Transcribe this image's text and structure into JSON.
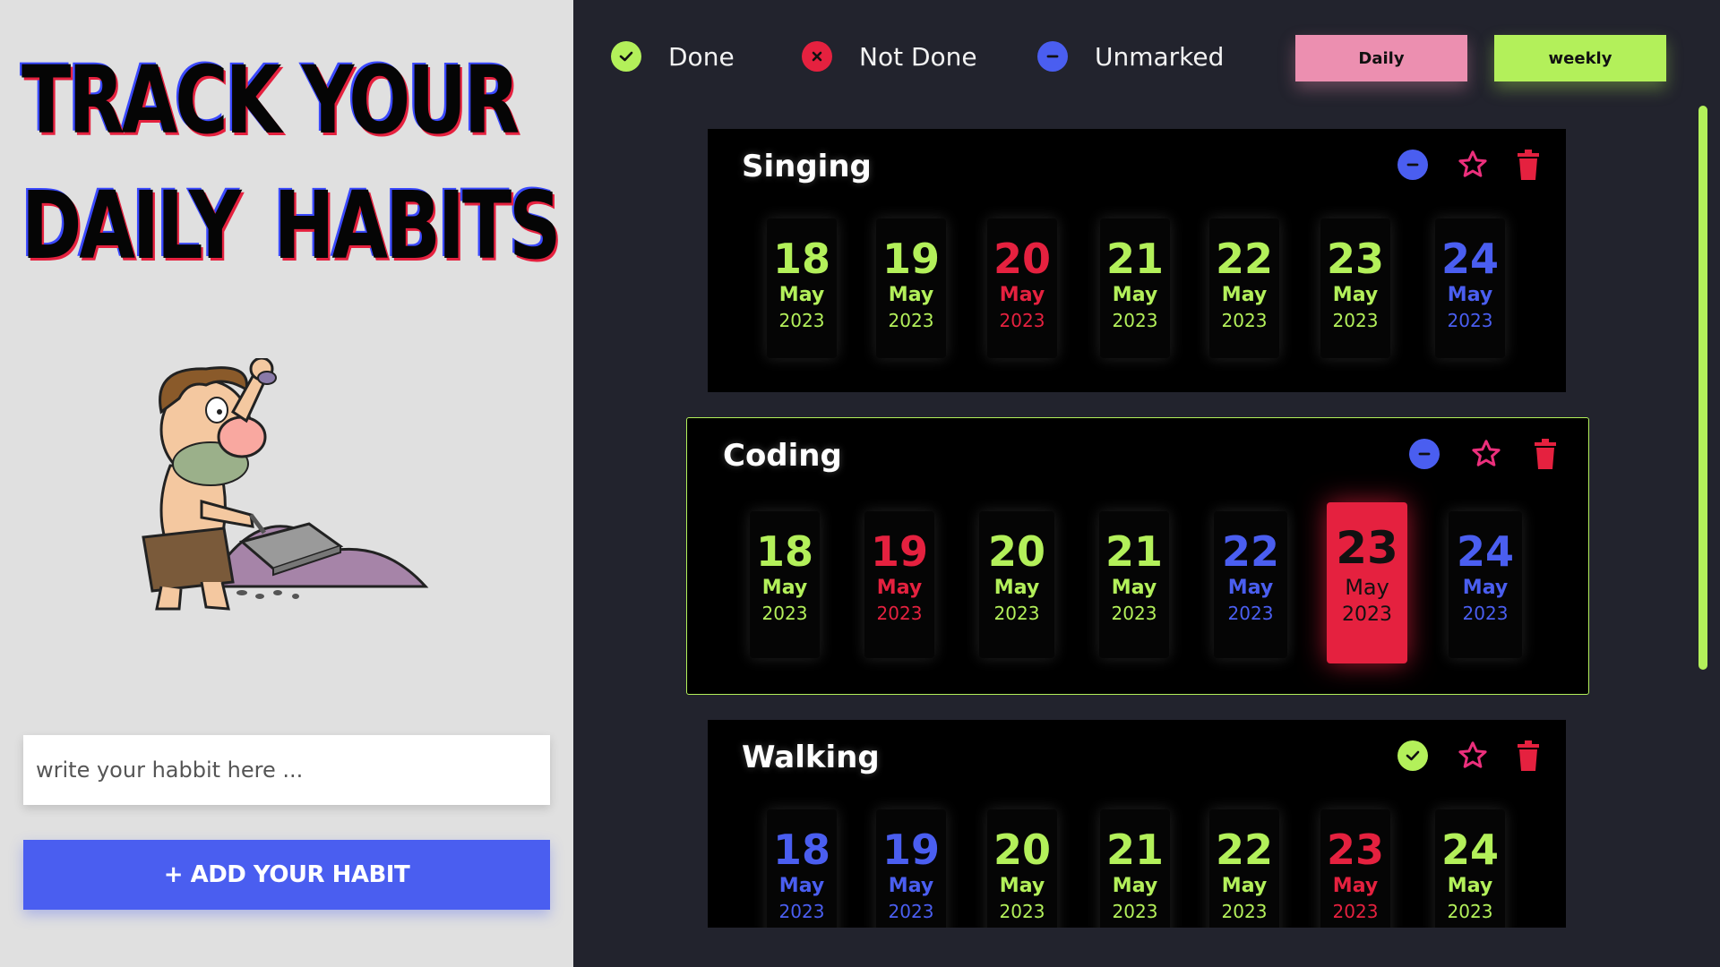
{
  "headline": {
    "line1": "TRACK YOUR",
    "line2": "DAILY HABITS"
  },
  "input": {
    "placeholder": "write your habbit here ..."
  },
  "add_button": {
    "label": "+ ADD YOUR HABIT"
  },
  "legend": {
    "done": {
      "label": "Done",
      "icon": "check-icon",
      "color": "#b3f05a"
    },
    "not_done": {
      "label": "Not Done",
      "icon": "x-icon",
      "color": "#e5213f"
    },
    "unmarked": {
      "label": "Unmarked",
      "icon": "minus-icon",
      "color": "#4a5ef0"
    }
  },
  "tabs": {
    "daily": "Daily",
    "weekly": "weekly"
  },
  "habits": [
    {
      "name": "Singing",
      "status": "unmarked",
      "days": [
        {
          "day": "18",
          "month": "May",
          "year": "2023",
          "status": "done"
        },
        {
          "day": "19",
          "month": "May",
          "year": "2023",
          "status": "done"
        },
        {
          "day": "20",
          "month": "May",
          "year": "2023",
          "status": "notdone"
        },
        {
          "day": "21",
          "month": "May",
          "year": "2023",
          "status": "done"
        },
        {
          "day": "22",
          "month": "May",
          "year": "2023",
          "status": "done"
        },
        {
          "day": "23",
          "month": "May",
          "year": "2023",
          "status": "done"
        },
        {
          "day": "24",
          "month": "May",
          "year": "2023",
          "status": "unmarked"
        }
      ]
    },
    {
      "name": "Coding",
      "status": "unmarked",
      "days": [
        {
          "day": "18",
          "month": "May",
          "year": "2023",
          "status": "done"
        },
        {
          "day": "19",
          "month": "May",
          "year": "2023",
          "status": "notdone"
        },
        {
          "day": "20",
          "month": "May",
          "year": "2023",
          "status": "done"
        },
        {
          "day": "21",
          "month": "May",
          "year": "2023",
          "status": "done"
        },
        {
          "day": "22",
          "month": "May",
          "year": "2023",
          "status": "unmarked"
        },
        {
          "day": "23",
          "month": "May",
          "year": "2023",
          "status": "notdone",
          "selected": true
        },
        {
          "day": "24",
          "month": "May",
          "year": "2023",
          "status": "unmarked"
        }
      ]
    },
    {
      "name": "Walking",
      "status": "done",
      "days": [
        {
          "day": "18",
          "month": "May",
          "year": "2023",
          "status": "unmarked"
        },
        {
          "day": "19",
          "month": "May",
          "year": "2023",
          "status": "unmarked"
        },
        {
          "day": "20",
          "month": "May",
          "year": "2023",
          "status": "done"
        },
        {
          "day": "21",
          "month": "May",
          "year": "2023",
          "status": "done"
        },
        {
          "day": "22",
          "month": "May",
          "year": "2023",
          "status": "done"
        },
        {
          "day": "23",
          "month": "May",
          "year": "2023",
          "status": "notdone"
        },
        {
          "day": "24",
          "month": "May",
          "year": "2023",
          "status": "done"
        }
      ]
    }
  ],
  "colors": {
    "done": "#b3f05a",
    "notdone": "#e5213f",
    "unmarked": "#4a5ef0",
    "accent_pink": "#ec8fb0"
  }
}
